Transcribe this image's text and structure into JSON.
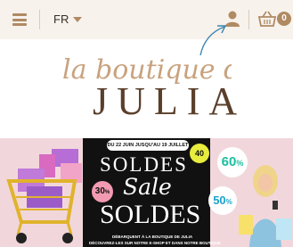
{
  "header": {
    "language": "FR",
    "cart_count": "0",
    "icons": [
      "hamburger-menu-icon",
      "user-icon",
      "basket-icon"
    ]
  },
  "logo": {
    "script_text": "la boutique de",
    "name": "JULIA"
  },
  "banner": {
    "date_range": "DU 22 JUIN JUSQU'AU 19 JUILLET",
    "headline_top": "SOLDES",
    "headline_script": "Sale",
    "headline_bottom": "SOLDES",
    "discount_30": "30",
    "discount_40": "40",
    "discount_60": "60",
    "discount_50": "50",
    "line1": "DÉBARQUENT À LA BOUTIQUE DE JULIA",
    "line2": "DÉCOUVREZ-LES SUR NOTRE E-SHOP ET DANS NOTRE BOUTIQUE"
  },
  "colors": {
    "header_bg": "#f7f2ec",
    "accent": "#b08a63",
    "banner_pink": "#f1d7dc",
    "banner_black": "#111111"
  }
}
